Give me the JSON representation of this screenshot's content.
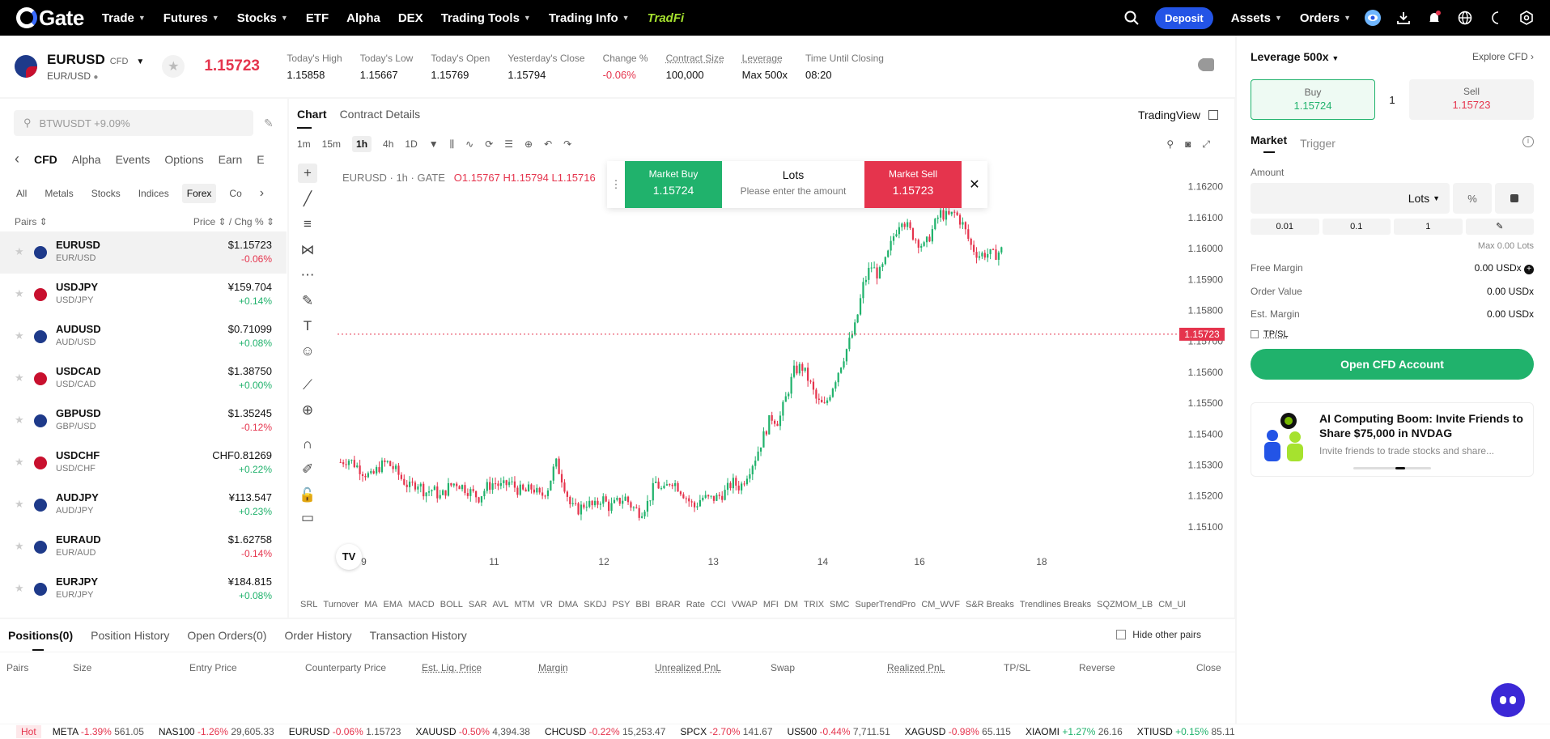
{
  "nav": {
    "logo": "Gate",
    "items": [
      {
        "label": "Trade",
        "caret": true
      },
      {
        "label": "Futures",
        "caret": true
      },
      {
        "label": "Stocks",
        "caret": true
      },
      {
        "label": "ETF",
        "caret": false
      },
      {
        "label": "Alpha",
        "caret": false
      },
      {
        "label": "DEX",
        "caret": false
      },
      {
        "label": "Trading Tools",
        "caret": true
      },
      {
        "label": "Trading Info",
        "caret": true
      }
    ],
    "tradfi": "TradFi",
    "deposit": "Deposit",
    "assets": "Assets",
    "orders": "Orders"
  },
  "symbol": {
    "name": "EURUSD",
    "tag": "CFD",
    "sub": "EUR/USD",
    "price": "1.15723",
    "stats": [
      {
        "label": "Today's High",
        "value": "1.15858",
        "dotted": false,
        "neg": false
      },
      {
        "label": "Today's Low",
        "value": "1.15667",
        "dotted": false,
        "neg": false
      },
      {
        "label": "Today's Open",
        "value": "1.15769",
        "dotted": false,
        "neg": false
      },
      {
        "label": "Yesterday's Close",
        "value": "1.15794",
        "dotted": false,
        "neg": false
      },
      {
        "label": "Change %",
        "value": "-0.06%",
        "dotted": false,
        "neg": true
      },
      {
        "label": "Contract Size",
        "value": "100,000",
        "dotted": true,
        "neg": false
      },
      {
        "label": "Leverage",
        "value": "Max 500x",
        "dotted": true,
        "neg": false
      },
      {
        "label": "Time Until Closing",
        "value": "08:20",
        "dotted": false,
        "neg": false
      }
    ]
  },
  "left": {
    "search_placeholder": "BTWUSDT +9.09%",
    "cat_tabs": [
      "CFD",
      "Alpha",
      "Events",
      "Options",
      "Earn",
      "E"
    ],
    "sub_tabs": [
      "All",
      "Metals",
      "Stocks",
      "Indices",
      "Forex",
      "Co"
    ],
    "col_pairs": "Pairs",
    "col_price": "Price",
    "col_chg": "/ Chg %",
    "rows": [
      {
        "name": "EURUSD",
        "sub": "EUR/USD",
        "price": "$1.15723",
        "chg": "-0.06%",
        "dir": "neg"
      },
      {
        "name": "USDJPY",
        "sub": "USD/JPY",
        "price": "¥159.704",
        "chg": "+0.14%",
        "dir": "pos"
      },
      {
        "name": "AUDUSD",
        "sub": "AUD/USD",
        "price": "$0.71099",
        "chg": "+0.08%",
        "dir": "pos"
      },
      {
        "name": "USDCAD",
        "sub": "USD/CAD",
        "price": "$1.38750",
        "chg": "+0.00%",
        "dir": "pos"
      },
      {
        "name": "GBPUSD",
        "sub": "GBP/USD",
        "price": "$1.35245",
        "chg": "-0.12%",
        "dir": "neg"
      },
      {
        "name": "USDCHF",
        "sub": "USD/CHF",
        "price": "CHF0.81269",
        "chg": "+0.22%",
        "dir": "pos"
      },
      {
        "name": "AUDJPY",
        "sub": "AUD/JPY",
        "price": "¥113.547",
        "chg": "+0.23%",
        "dir": "pos"
      },
      {
        "name": "EURAUD",
        "sub": "EUR/AUD",
        "price": "$1.62758",
        "chg": "-0.14%",
        "dir": "neg"
      },
      {
        "name": "EURJPY",
        "sub": "EUR/JPY",
        "price": "¥184.815",
        "chg": "+0.08%",
        "dir": "pos"
      }
    ]
  },
  "chart": {
    "tabs": [
      "Chart",
      "Contract Details"
    ],
    "tradingview": "TradingView",
    "intervals": [
      "1m",
      "15m",
      "1h",
      "4h",
      "1D"
    ],
    "active_interval": "1h",
    "legend_symbol": "EURUSD · 1h · GATE",
    "o": "O1.15767",
    "h": "H1.15794",
    "l": "L1.15716",
    "popup": {
      "buy_label": "Market Buy",
      "buy_price": "1.15724",
      "lots": "Lots",
      "lots_hint": "Please enter the amount",
      "sell_label": "Market Sell",
      "sell_price": "1.15723"
    },
    "current_price_label": "1.15723",
    "y_ticks": [
      "1.16200",
      "1.16100",
      "1.16000",
      "1.15900",
      "1.15800",
      "1.15700",
      "1.15600",
      "1.15500",
      "1.15400",
      "1.15300",
      "1.15200",
      "1.15100"
    ],
    "x_ticks": [
      "9",
      "11",
      "12",
      "13",
      "14",
      "16",
      "18"
    ],
    "indicators": [
      "SRL",
      "Turnover",
      "MA",
      "EMA",
      "MACD",
      "BOLL",
      "SAR",
      "AVL",
      "MTM",
      "VR",
      "DMA",
      "SKDJ",
      "PSY",
      "BBI",
      "BRAR",
      "Rate",
      "CCI",
      "VWAP",
      "MFI",
      "DM",
      "TRIX",
      "SMC",
      "SuperTrendPro",
      "CM_WVF",
      "S&R Breaks",
      "Trendlines Breaks",
      "SQZMOM_LB",
      "CM_Ul"
    ],
    "colors": {
      "up": "#20b26c",
      "down": "#e5344d"
    }
  },
  "right": {
    "leverage": "Leverage 500x",
    "explore": "Explore CFD",
    "buy_label": "Buy",
    "buy_price": "1.15724",
    "qty": "1",
    "sell_label": "Sell",
    "sell_price": "1.15723",
    "tabs": [
      "Market",
      "Trigger"
    ],
    "amount_label": "Amount",
    "lots_select": "Lots",
    "pct": "%",
    "quick": [
      "0.01",
      "0.1",
      "1"
    ],
    "max_lots": "Max 0.00 Lots",
    "free_margin_k": "Free Margin",
    "free_margin_v": "0.00 USDx",
    "order_value_k": "Order Value",
    "order_value_v": "0.00 USDx",
    "est_margin_k": "Est. Margin",
    "est_margin_v": "0.00 USDx",
    "tpsl": "TP/SL",
    "open_btn": "Open CFD Account",
    "promo_title": "AI Computing Boom: Invite Friends to Share $75,000 in NVDAG",
    "promo_desc": "Invite friends to trade stocks and share..."
  },
  "bottom": {
    "tabs": [
      "Positions(0)",
      "Position History",
      "Open Orders(0)",
      "Order History",
      "Transaction History"
    ],
    "hide_other": "Hide other pairs",
    "cols": [
      "Pairs",
      "Size",
      "Entry Price",
      "Counterparty Price",
      "Est. Liq. Price",
      "Margin",
      "Unrealized PnL",
      "Swap",
      "Realized PnL",
      "TP/SL",
      "Reverse",
      "Close"
    ]
  },
  "ticker": {
    "hot": "Hot",
    "items": [
      {
        "n": "META",
        "c": "-1.39%",
        "p": "561.05",
        "d": "neg"
      },
      {
        "n": "NAS100",
        "c": "-1.26%",
        "p": "29,605.33",
        "d": "neg"
      },
      {
        "n": "EURUSD",
        "c": "-0.06%",
        "p": "1.15723",
        "d": "neg"
      },
      {
        "n": "XAUUSD",
        "c": "-0.50%",
        "p": "4,394.38",
        "d": "neg"
      },
      {
        "n": "CHCUSD",
        "c": "-0.22%",
        "p": "15,253.47",
        "d": "neg"
      },
      {
        "n": "SPCX",
        "c": "-2.70%",
        "p": "141.67",
        "d": "neg"
      },
      {
        "n": "US500",
        "c": "-0.44%",
        "p": "7,711.51",
        "d": "neg"
      },
      {
        "n": "XAGUSD",
        "c": "-0.98%",
        "p": "65.115",
        "d": "neg"
      },
      {
        "n": "XIAOMI",
        "c": "+1.27%",
        "p": "26.16",
        "d": "pos"
      },
      {
        "n": "XTIUSD",
        "c": "+0.15%",
        "p": "85.11",
        "d": "pos"
      }
    ]
  }
}
